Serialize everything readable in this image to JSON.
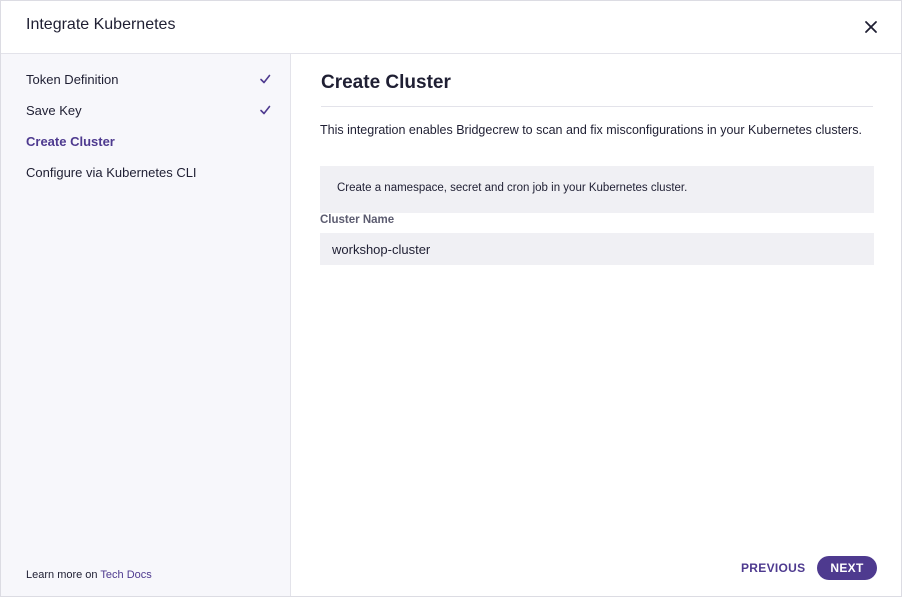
{
  "modal": {
    "title": "Integrate Kubernetes",
    "close_icon": "close-icon"
  },
  "sidebar": {
    "steps": [
      {
        "label": "Token Definition",
        "completed": true,
        "active": false
      },
      {
        "label": "Save Key",
        "completed": true,
        "active": false
      },
      {
        "label": "Create Cluster",
        "completed": false,
        "active": true
      },
      {
        "label": "Configure via Kubernetes CLI",
        "completed": false,
        "active": false
      }
    ],
    "footer": {
      "text": "Learn more on ",
      "link_label": "Tech Docs"
    }
  },
  "main": {
    "title": "Create Cluster",
    "intro": "This integration enables Bridgecrew to scan and fix misconfigurations in your Kubernetes clusters.",
    "info": "Create a namespace, secret and cron job in your Kubernetes cluster.",
    "cluster_name": {
      "label": "Cluster Name",
      "value": "workshop-cluster"
    }
  },
  "actions": {
    "previous_label": "PREVIOUS",
    "next_label": "NEXT"
  },
  "colors": {
    "accent": "#4e3a8f",
    "sidebar_bg": "#f7f7fb",
    "input_bg": "#f0f0f4"
  }
}
